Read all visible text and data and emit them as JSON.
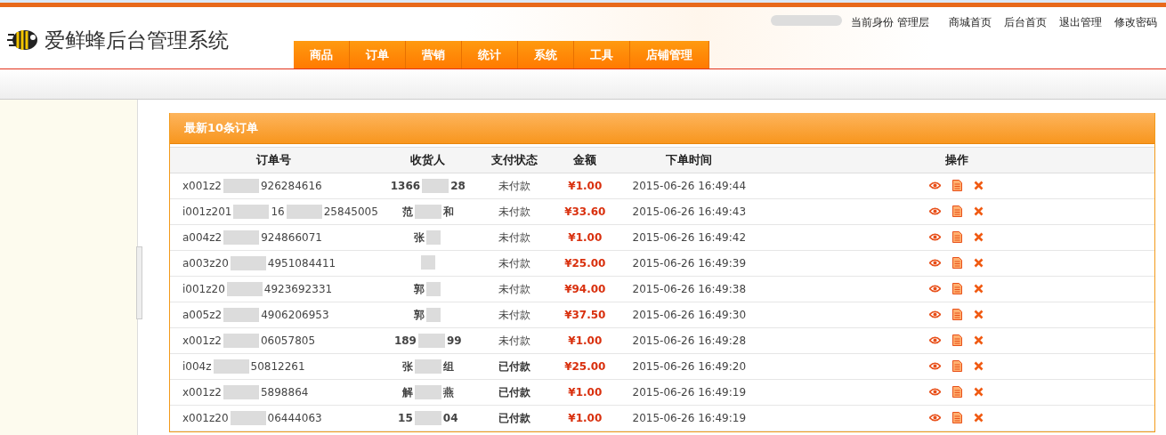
{
  "header": {
    "title": "爱鲜蜂后台管理系统",
    "identity": "当前身份 管理层",
    "links": [
      "商城首页",
      "后台首页",
      "退出管理",
      "修改密码"
    ],
    "nav": [
      {
        "label": "商品",
        "selected": false
      },
      {
        "label": "订单",
        "selected": false
      },
      {
        "label": "营销",
        "selected": false
      },
      {
        "label": "统计",
        "selected": false
      },
      {
        "label": "系统",
        "selected": false
      },
      {
        "label": "工具",
        "selected": false
      },
      {
        "label": "店铺管理",
        "selected": false
      }
    ]
  },
  "panel": {
    "title": "最新10条订单",
    "columns": [
      "订单号",
      "收货人",
      "支付状态",
      "金额",
      "下单时间",
      "操作"
    ],
    "rows": [
      {
        "order_no": [
          "x001z2",
          "926284616"
        ],
        "receiver": [
          "1366",
          "28"
        ],
        "status": "未付款",
        "paid": false,
        "amount": "¥1.00",
        "time": "2015-06-26 16:49:44"
      },
      {
        "order_no": [
          "i001z201",
          "16",
          "25845005"
        ],
        "receiver": [
          "范",
          "和"
        ],
        "status": "未付款",
        "paid": false,
        "amount": "¥33.60",
        "time": "2015-06-26 16:49:43"
      },
      {
        "order_no": [
          "a004z2",
          "924866071"
        ],
        "receiver": [
          "张"
        ],
        "status": "未付款",
        "paid": false,
        "amount": "¥1.00",
        "time": "2015-06-26 16:49:42"
      },
      {
        "order_no": [
          "a003z20",
          "4951084411"
        ],
        "status": "未付款",
        "paid": false,
        "amount": "¥25.00",
        "time": "2015-06-26 16:49:39"
      },
      {
        "order_no": [
          "i001z20",
          "4923692331"
        ],
        "receiver": [
          "郭"
        ],
        "status": "未付款",
        "paid": false,
        "amount": "¥94.00",
        "time": "2015-06-26 16:49:38"
      },
      {
        "order_no": [
          "a005z2",
          "4906206953"
        ],
        "receiver": [
          "郭"
        ],
        "status": "未付款",
        "paid": false,
        "amount": "¥37.50",
        "time": "2015-06-26 16:49:30"
      },
      {
        "order_no": [
          "x001z2",
          "06057805"
        ],
        "receiver": [
          "189",
          "99"
        ],
        "status": "未付款",
        "paid": false,
        "amount": "¥1.00",
        "time": "2015-06-26 16:49:28"
      },
      {
        "order_no": [
          "i004z",
          "50812261"
        ],
        "receiver": [
          "张",
          "组"
        ],
        "status": "已付款",
        "paid": true,
        "amount": "¥25.00",
        "time": "2015-06-26 16:49:20"
      },
      {
        "order_no": [
          "x001z2",
          "5898864"
        ],
        "receiver": [
          "解",
          "燕"
        ],
        "status": "已付款",
        "paid": true,
        "amount": "¥1.00",
        "time": "2015-06-26 16:49:19"
      },
      {
        "order_no": [
          "x001z20",
          "06444063"
        ],
        "receiver": [
          "15",
          "04"
        ],
        "status": "已付款",
        "paid": true,
        "amount": "¥1.00",
        "time": "2015-06-26 16:49:19"
      }
    ]
  }
}
